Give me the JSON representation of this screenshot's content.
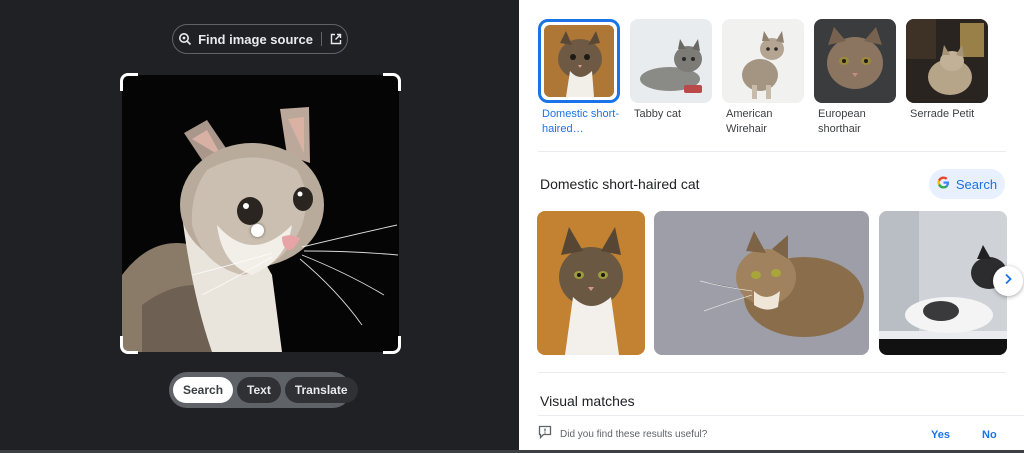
{
  "left_panel": {
    "find_source_label": "Find image source",
    "modes": [
      "Search",
      "Text",
      "Translate"
    ],
    "active_mode": "Search"
  },
  "entities": [
    {
      "label": "Domestic short-haired…",
      "selected": true
    },
    {
      "label": "Tabby cat",
      "selected": false
    },
    {
      "label": "American Wirehair",
      "selected": false
    },
    {
      "label": "European shorthair",
      "selected": false
    },
    {
      "label": "Serrade Petit",
      "selected": false
    }
  ],
  "section": {
    "title": "Domestic short-haired cat",
    "search_label": "Search"
  },
  "visual_matches_title": "Visual matches",
  "feedback": {
    "question": "Did you find these results useful?",
    "yes": "Yes",
    "no": "No"
  },
  "icons": {
    "find_source": "lens-search-icon",
    "external": "open-in-new-icon",
    "google": "google-g-icon",
    "next": "chevron-right-icon",
    "feedback": "feedback-icon"
  },
  "colors": {
    "accent": "#1a73e8",
    "left_bg": "#202124"
  }
}
